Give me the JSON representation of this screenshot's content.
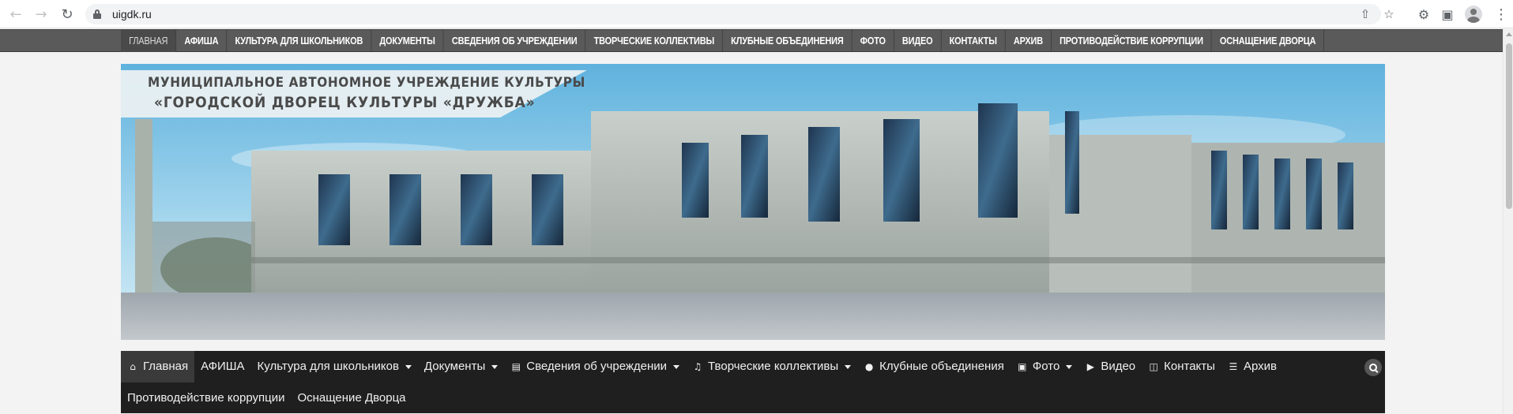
{
  "browser": {
    "url": "uigdk.ru",
    "icons": [
      "back-icon",
      "forward-icon",
      "reload-icon",
      "lock-icon",
      "share-icon",
      "star-icon",
      "extensions-icon",
      "side-panel-icon",
      "profile-icon",
      "kebab-menu-icon"
    ]
  },
  "top_nav": {
    "items": [
      {
        "label": "ГЛАВНАЯ",
        "active": true
      },
      {
        "label": "АФИША"
      },
      {
        "label": "КУЛЬТУРА ДЛЯ ШКОЛЬНИКОВ"
      },
      {
        "label": "ДОКУМЕНТЫ"
      },
      {
        "label": "СВЕДЕНИЯ ОБ УЧРЕЖДЕНИИ"
      },
      {
        "label": "ТВОРЧЕСКИЕ КОЛЛЕКТИВЫ"
      },
      {
        "label": "КЛУБНЫЕ ОБЪЕДИНЕНИЯ"
      },
      {
        "label": "ФОТО"
      },
      {
        "label": "ВИДЕО"
      },
      {
        "label": "КОНТАКТЫ"
      },
      {
        "label": "АРХИВ"
      },
      {
        "label": "ПРОТИВОДЕЙСТВИЕ КОРРУПЦИИ"
      },
      {
        "label": "ОСНАЩЕНИЕ ДВОРЦА"
      }
    ]
  },
  "banner": {
    "line1": "Муниципальное автономное учреждение культуры",
    "line2": "«Городской дворец культуры «Дружба»"
  },
  "main_nav": {
    "row1": [
      {
        "label": "Главная",
        "icon": "home-icon",
        "active": true
      },
      {
        "label": "АФИША"
      },
      {
        "label": "Культура для школьников",
        "dropdown": true
      },
      {
        "label": "Документы",
        "dropdown": true
      },
      {
        "label": "Сведения об учреждении",
        "icon": "note-icon",
        "dropdown": true
      },
      {
        "label": "Творческие коллективы",
        "icon": "music-icon",
        "dropdown": true
      },
      {
        "label": "Клубные объединения",
        "icon": "user-icon"
      },
      {
        "label": "Фото",
        "icon": "camera-icon",
        "dropdown": true
      },
      {
        "label": "Видео",
        "icon": "video-icon"
      },
      {
        "label": "Контакты",
        "icon": "inbox-icon"
      },
      {
        "label": "Архив",
        "icon": "list-icon"
      }
    ],
    "row2": [
      {
        "label": "Противодействие коррупции"
      },
      {
        "label": "Оснащение Дворца"
      }
    ],
    "search_icon": "search-icon"
  }
}
